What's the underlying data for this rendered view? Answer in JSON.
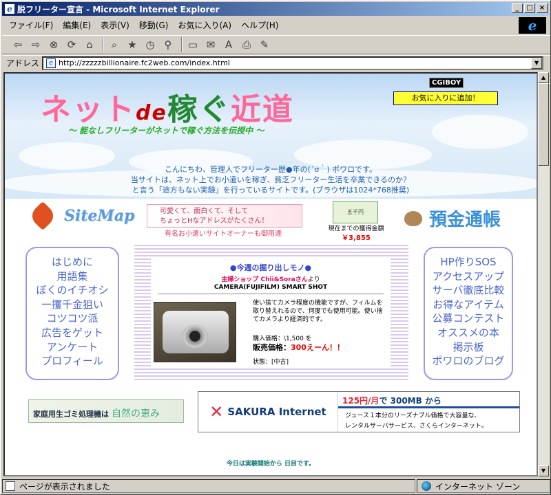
{
  "window": {
    "title": "脱フリーター宣言 - Microsoft Internet Explorer",
    "min": "_",
    "max": "□",
    "close": "×"
  },
  "menu": [
    "ファイル(F)",
    "編集(E)",
    "表示(V)",
    "移動(G)",
    "お気に入り(A)",
    "ヘルプ(H)"
  ],
  "address": {
    "label": "アドレス",
    "url": "http://zzzzzbillionaire.fc2web.com/index.html"
  },
  "status": {
    "left": "ページが表示されました",
    "zone": "インターネット ゾーン"
  },
  "page": {
    "logo": {
      "a": "ネット",
      "b": "de",
      "c": "稼ぐ",
      "d": "近道"
    },
    "tagline": "～ 能なしフリーターがネットで稼ぐ方法を伝授中 ～",
    "cgiboy": "CGIBOY",
    "fav_button": "お気に入りに追加！",
    "intro": [
      "こんにちわ、管理人でフリーター歴●年の(´σ｀) ポワロです。",
      "当サイトは、ネット上でお小遣いを稼ぎ、貧乏フリーター生活を卒業できるのか？",
      "と言う「途方もない実験」を行っているサイトです。(ブラウザは1024*768推奨)"
    ],
    "sitemap": "SiteMap",
    "pink_ad": [
      "可愛くて、面白くて、そして",
      "ちょっとHなアドレスがたくさん！"
    ],
    "owner_line": "有名お小遣いサイトオーナーも御用達",
    "money_note": "五千円",
    "earned_label": "現在までの獲得金額",
    "earned_value": "￥3,855",
    "yokin": "預金通帳",
    "nav_left": [
      "はじめに",
      "用語集",
      "ぼくのイチオシ",
      "一攫千金狙い",
      "コツコツ派",
      "広告をゲット",
      "アンケート",
      "プロフィール"
    ],
    "nav_right": [
      "HP作りSOS",
      "アクセスアップ",
      "サーバ徹底比較",
      "お得なアイテム",
      "公募コンテスト",
      "オススメの本",
      "掲示板",
      "ポワロのブログ"
    ],
    "feature": {
      "title": "●今週の掘り出しモノ●",
      "shop": "主婦ショップ Chii&Soraさん",
      "shop_suffix": "より",
      "product": "CAMERA(FUJIFILM) SMART SHOT",
      "desc": "使い捨てカメラ程度の機能ですが、フィルムを取り替えれるので、何度でも使用可能。使い捨てカメラより経済的です。",
      "buy_price": "購入価格：\\1,500 を",
      "sale_label": "販売価格：",
      "sale_price": "300えーん！！",
      "state": "状態：[中古]"
    },
    "gomi": {
      "text": "家庭用生ゴミ処理機は",
      "brand": "自然の恵み"
    },
    "sakura": {
      "name": "SAKURA Internet",
      "price": "125円/月",
      "price_rest": "で 300MB から",
      "line1": "ジュース１本分のリーズナブル価格で大容量な、",
      "line2": "レンタルサーバサービス、さくらインターネット。"
    },
    "today": "今日は実験開始から 日目です。"
  }
}
